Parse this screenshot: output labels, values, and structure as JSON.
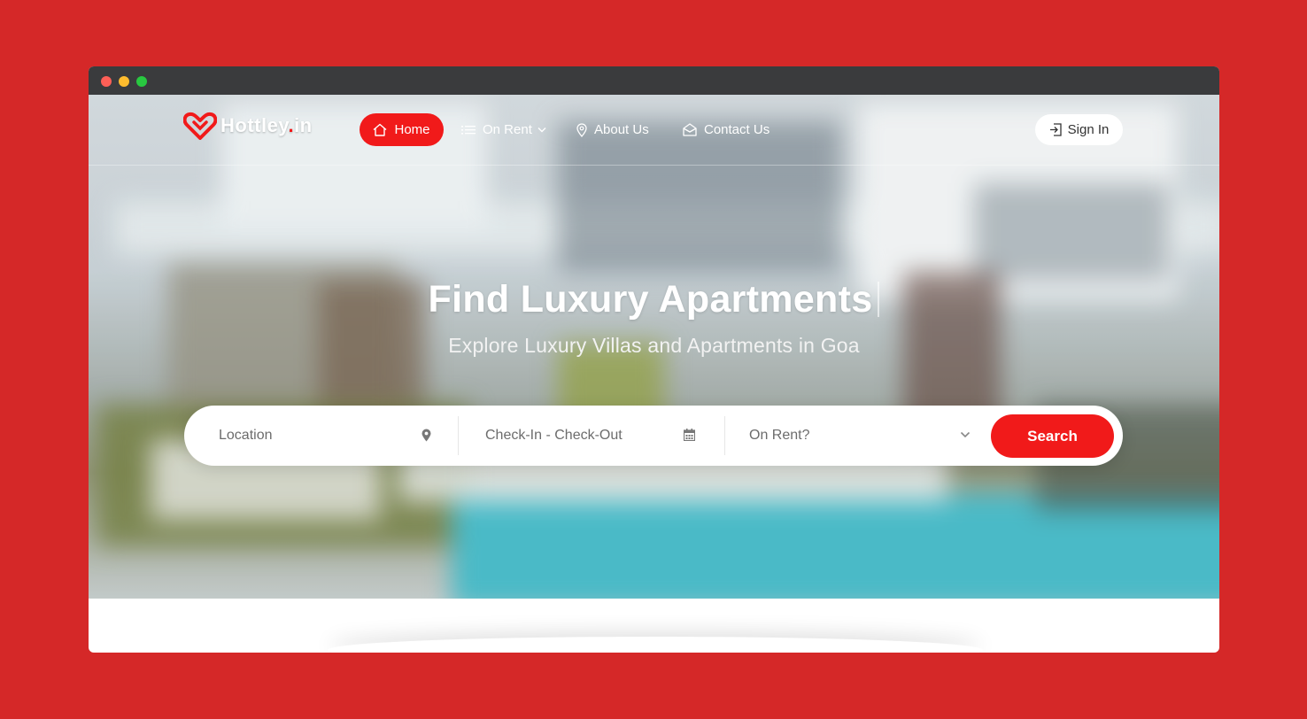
{
  "brand": {
    "name_main": "Hottley",
    "name_dot": ".",
    "name_tld": "in",
    "accent": "#f11a1a"
  },
  "nav": {
    "items": [
      {
        "label": "Home",
        "icon": "home-icon",
        "active": true
      },
      {
        "label": "On Rent",
        "icon": "list-icon",
        "dropdown": true
      },
      {
        "label": "About Us",
        "icon": "map-pin-icon"
      },
      {
        "label": "Contact Us",
        "icon": "envelope-open-icon"
      }
    ],
    "signin_label": "Sign In"
  },
  "hero": {
    "title": "Find Luxury Apartments",
    "subtitle": "Explore Luxury Villas and Apartments in Goa"
  },
  "search": {
    "location_placeholder": "Location",
    "dates_placeholder": "Check-In - Check-Out",
    "rent_placeholder": "On Rent?",
    "button_label": "Search"
  },
  "colors": {
    "page_bg": "#d52828",
    "window_bar": "#3a3b3d",
    "accent": "#f11a1a"
  }
}
